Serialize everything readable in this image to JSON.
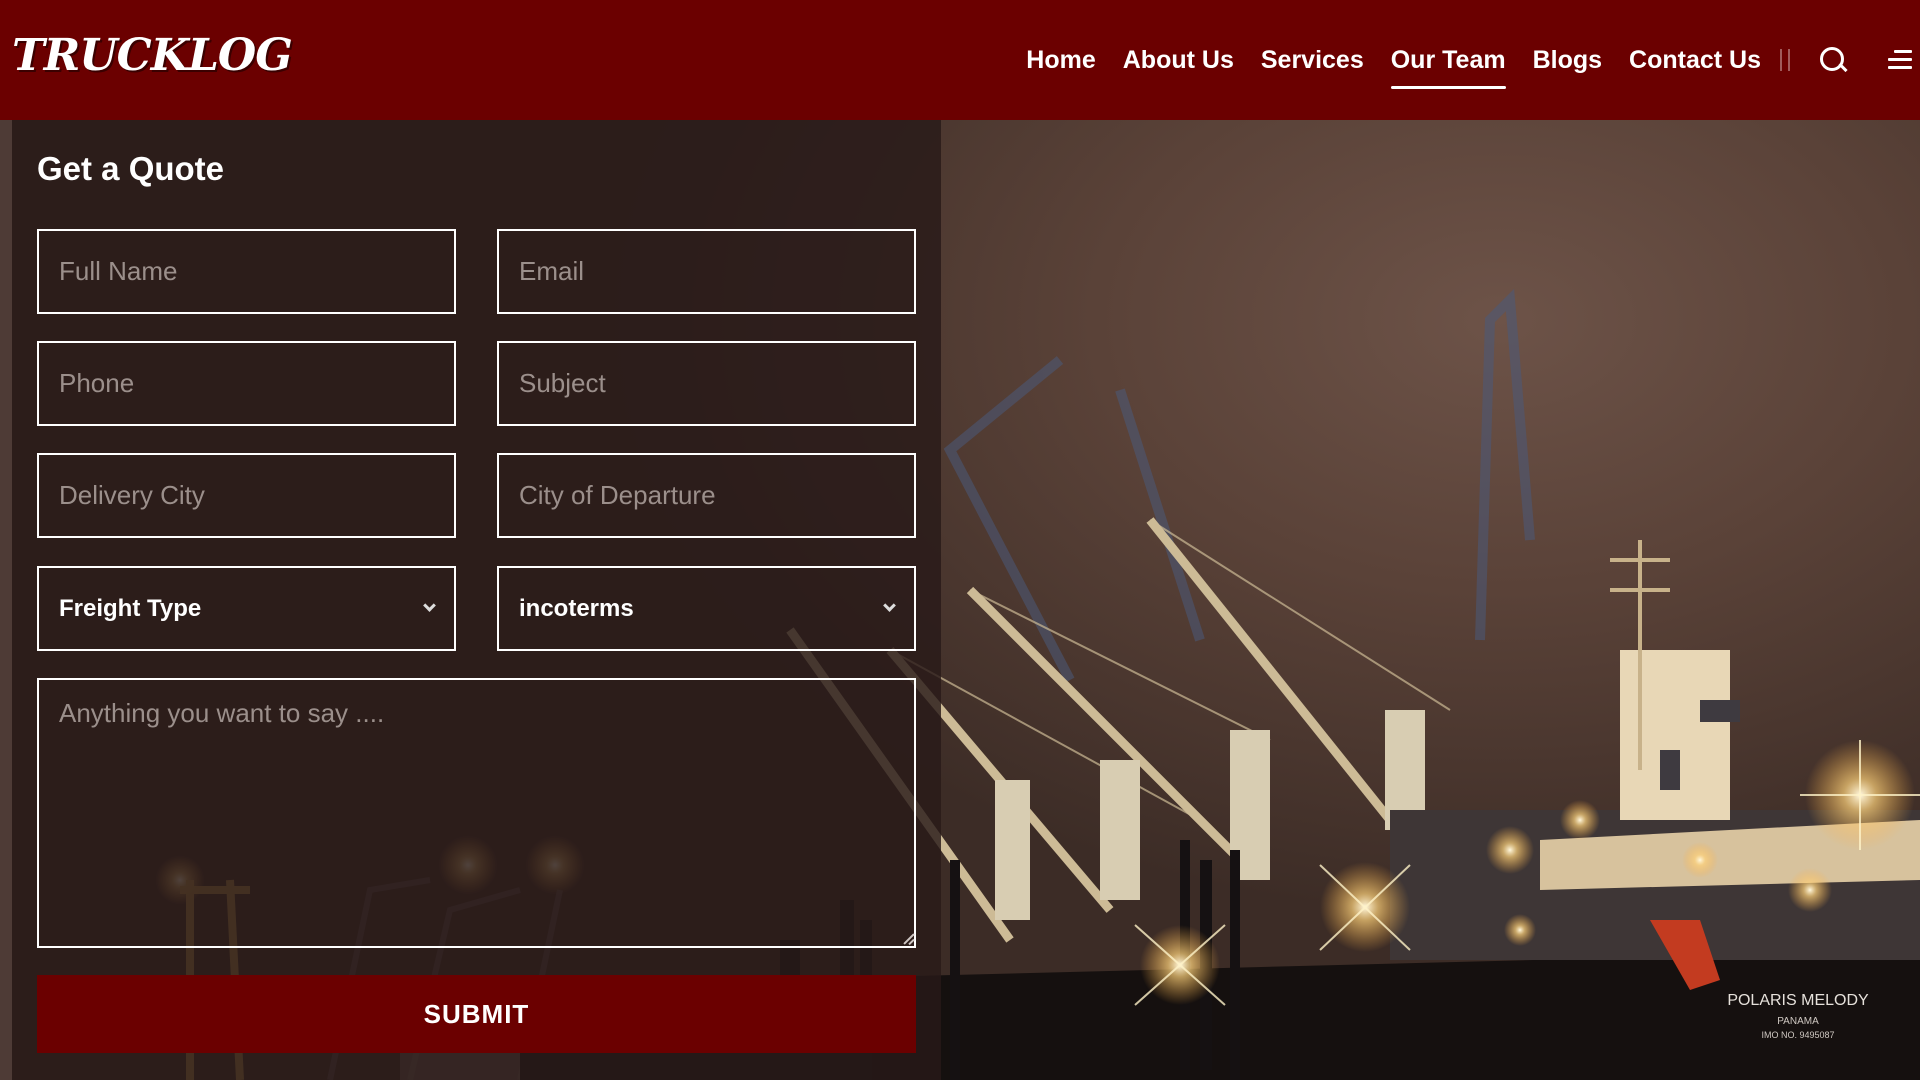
{
  "header": {
    "logo": "TRUCKLOG",
    "nav": [
      {
        "label": "Home"
      },
      {
        "label": "About Us"
      },
      {
        "label": "Services"
      },
      {
        "label": "Our Team",
        "active": true
      },
      {
        "label": "Blogs"
      },
      {
        "label": "Contact Us"
      }
    ],
    "icons": [
      "search-icon",
      "menu-icon"
    ]
  },
  "form": {
    "title": "Get a Quote",
    "full_name_placeholder": "Full Name",
    "email_placeholder": "Email",
    "phone_placeholder": "Phone",
    "subject_placeholder": "Subject",
    "delivery_city_placeholder": "Delivery City",
    "departure_city_placeholder": "City of Departure",
    "freight_type": "Freight Type",
    "incoterms": "incoterms",
    "message_placeholder": "Anything you want to say ....",
    "submit_label": "SUBMIT"
  },
  "background": {
    "ship_name": "POLARIS MELODY",
    "ship_port": "PANAMA",
    "ship_imo": "IMO NO. 9495087"
  },
  "colors": {
    "brand": "#6b0000",
    "panel": "#281a18"
  }
}
